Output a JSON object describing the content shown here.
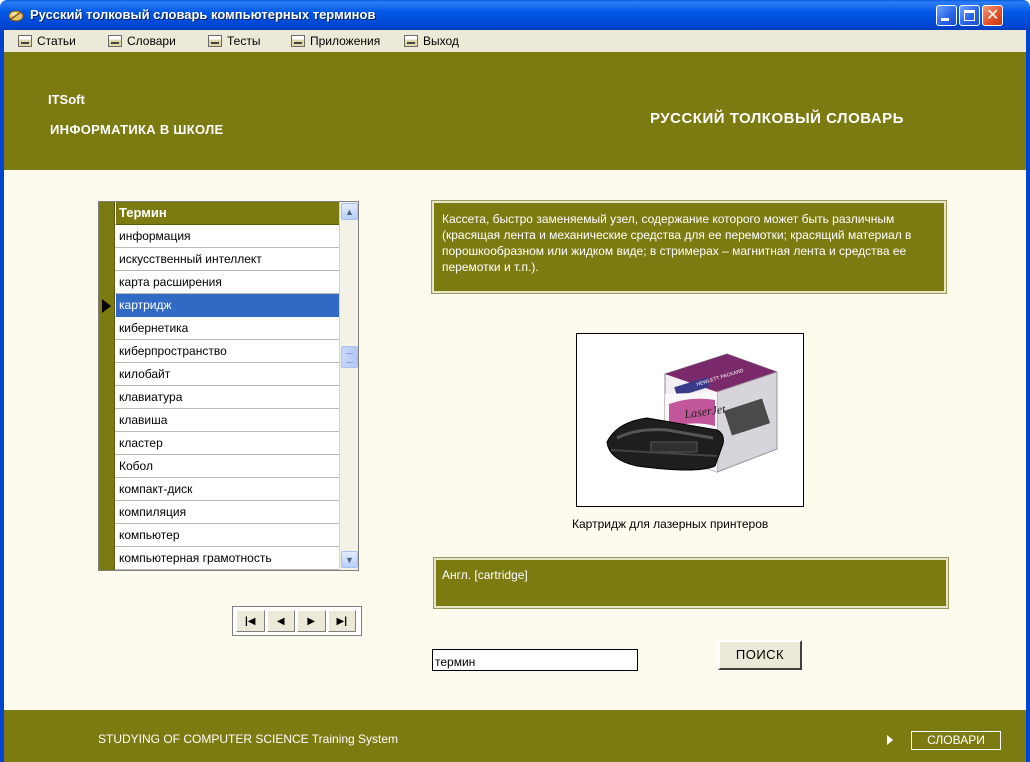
{
  "window": {
    "title": "Русский толковый словарь компьютерных терминов",
    "app_icon": "dictionary-app-icon",
    "close_glyph": "✕"
  },
  "menu": [
    {
      "label": "Статьи",
      "icon": "menu-item-icon"
    },
    {
      "label": "Словари",
      "icon": "menu-item-icon"
    },
    {
      "label": "Тесты",
      "icon": "menu-item-icon"
    },
    {
      "label": "Приложения",
      "icon": "menu-item-icon"
    },
    {
      "label": "Выход",
      "icon": "menu-item-icon"
    }
  ],
  "header": {
    "brand": "ITSoft",
    "subtitle": "ИНФОРМАТИКА В ШКОЛЕ",
    "title": "РУССКИЙ ТОЛКОВЫЙ СЛОВАРЬ"
  },
  "grid": {
    "column_header": "Термин",
    "rows": [
      "информация",
      "искусственный интеллект",
      "карта расширения",
      "картридж",
      "кибернетика",
      "киберпространство",
      "килобайт",
      "клавиатура",
      "клавиша",
      "кластер",
      "Кобол",
      "компакт-диск",
      "компиляция",
      "компьютер",
      "компьютерная грамотность"
    ],
    "selected_index": 3,
    "scroll_up_glyph": "▲",
    "scroll_down_glyph": "▼"
  },
  "navigator": {
    "first": "|◀",
    "prev": "◀",
    "next": "▶",
    "last": "▶|"
  },
  "definition": "Кассета, быстро заменяемый узел, содержание которого может быть различным (красящая лента и механические средства для ее перемотки; красящий материал в порошкообразном или жидком виде; в стримерах – магнитная лента и средства ее перемотки и т.п.).",
  "picture": {
    "caption": "Картридж для лазерных принтеров",
    "box_brand": "HEWLETT PACKARD",
    "box_label": "LaserJet"
  },
  "english": "Англ. [cartridge]",
  "search": {
    "value": "термин",
    "button": "ПОИСК"
  },
  "footer": {
    "text": "STUDYING OF COMPUTER SCIENCE Training System",
    "button": "СЛОВАРИ"
  },
  "colors": {
    "olive": "#7c7b12",
    "cream": "#fdfaee",
    "selection": "#316ac5",
    "title_blue": "#0058e6"
  }
}
